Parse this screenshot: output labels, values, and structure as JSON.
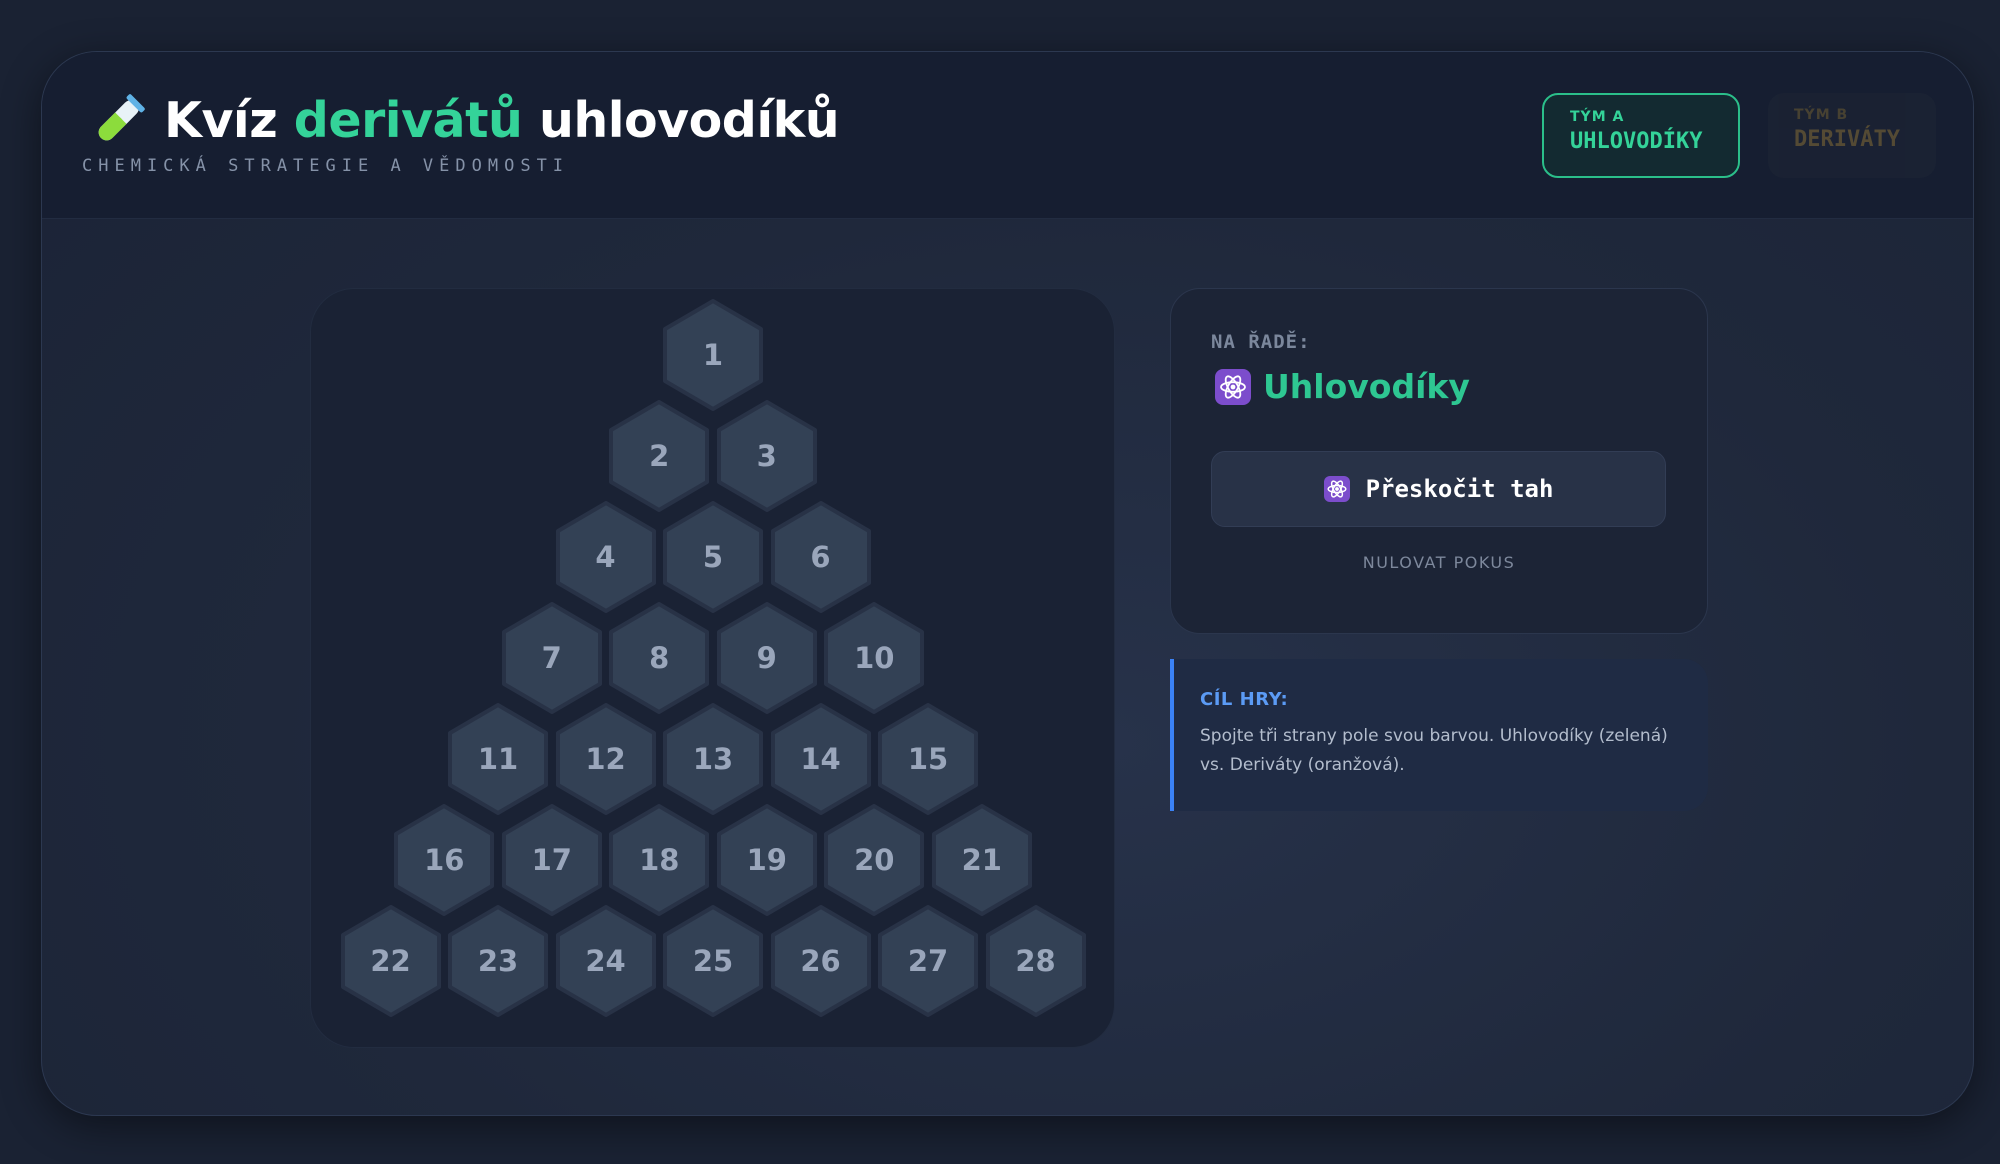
{
  "header": {
    "title_part1": "Kvíz ",
    "title_accent": "derivátů",
    "title_part2": " uhlovodíků",
    "subtitle": "CHEMICKÁ STRATEGIE A VĚDOMOSTI",
    "icon": "test-tube-icon"
  },
  "teams": [
    {
      "label": "TÝM A",
      "name": "UHLOVODÍKY",
      "active": true,
      "color": "#34d399"
    },
    {
      "label": "TÝM B",
      "name": "DERIVÁTY",
      "active": false,
      "color": "#f59e0b"
    }
  ],
  "board": {
    "rows": [
      [
        "1"
      ],
      [
        "2",
        "3"
      ],
      [
        "4",
        "5",
        "6"
      ],
      [
        "7",
        "8",
        "9",
        "10"
      ],
      [
        "11",
        "12",
        "13",
        "14",
        "15"
      ],
      [
        "16",
        "17",
        "18",
        "19",
        "20",
        "21"
      ],
      [
        "22",
        "23",
        "24",
        "25",
        "26",
        "27",
        "28"
      ]
    ]
  },
  "turn": {
    "label": "NA ŘADĚ:",
    "team_name": "Uhlovodíky",
    "icon": "atom-icon"
  },
  "actions": {
    "skip_label": "Přeskočit tah",
    "reset_label": "NULOVAT POKUS"
  },
  "goal": {
    "title": "CÍL HRY:",
    "text": "Spojte tři strany pole svou barvou. Uhlovodíky (zelená) vs. Deriváty (oranžová)."
  },
  "colors": {
    "accent_green": "#34d399",
    "accent_orange": "#f59e0b",
    "accent_blue": "#3b82f6",
    "atom_badge": "#7c4dcc"
  }
}
